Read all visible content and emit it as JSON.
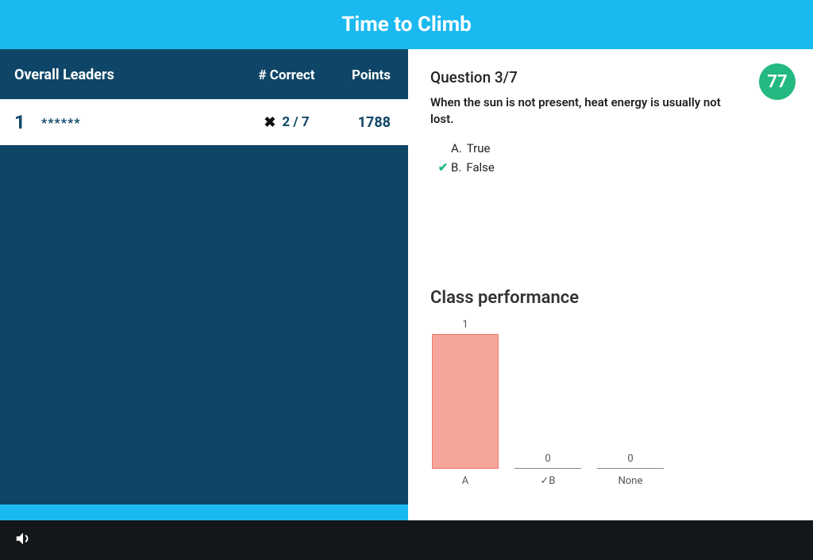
{
  "header": {
    "title": "Time to Climb"
  },
  "leaders": {
    "heading_overall": "Overall Leaders",
    "heading_correct": "# Correct",
    "heading_points": "Points",
    "rows": [
      {
        "rank": "1",
        "name": "******",
        "correct": "2 / 7",
        "points": "1788",
        "wrong": true
      }
    ]
  },
  "question": {
    "number_label": "Question 3/7",
    "text": "When the sun is not present, heat energy is usually not lost.",
    "score_badge": "77",
    "answers": [
      {
        "letter": "A.",
        "text": "True",
        "correct": false
      },
      {
        "letter": "B.",
        "text": "False",
        "correct": true
      }
    ]
  },
  "class_performance": {
    "title": "Class performance"
  },
  "chart_data": {
    "type": "bar",
    "title": "Class performance",
    "categories": [
      "A",
      "✓B",
      "None"
    ],
    "values": [
      1,
      0,
      0
    ],
    "ylim": [
      0,
      1
    ],
    "colors": [
      "#f5a59a",
      "#ffffff",
      "#ffffff"
    ],
    "xlabel": "",
    "ylabel": ""
  }
}
